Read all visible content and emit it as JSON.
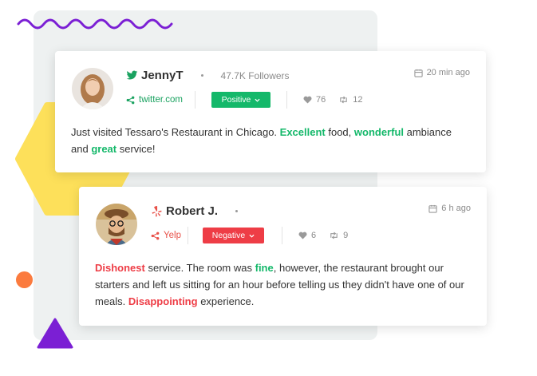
{
  "colors": {
    "positive": "#14b86a",
    "negative": "#ee3d46",
    "twitter": "#1da1f2",
    "yelp": "#e8524a",
    "accent_purple": "#7b1fd4",
    "accent_orange": "#fb7b3e",
    "accent_yellow": "#fde05a"
  },
  "reviews": [
    {
      "source_icon": "twitter-icon",
      "author": "JennyT",
      "followers": "47.7K Followers",
      "time": "20 min ago",
      "source_label": "twitter.com",
      "sentiment": "Positive",
      "likes": "76",
      "retweets": "12",
      "text": [
        {
          "t": "Just visited Tessaro's Restaurant in Chicago. "
        },
        {
          "t": "Excellent",
          "tone": "positive"
        },
        {
          "t": " food, "
        },
        {
          "t": "wonderful",
          "tone": "positive"
        },
        {
          "t": " ambiance and "
        },
        {
          "t": "great",
          "tone": "positive"
        },
        {
          "t": " service!"
        }
      ]
    },
    {
      "source_icon": "yelp-icon",
      "author": "Robert J.",
      "time": "6 h ago",
      "source_label": "Yelp",
      "sentiment": "Negative",
      "likes": "6",
      "retweets": "9",
      "text": [
        {
          "t": "Dishonest",
          "tone": "negative"
        },
        {
          "t": " service. The room was "
        },
        {
          "t": "fine",
          "tone": "positive"
        },
        {
          "t": ", however, the restaurant brought our starters and left us sitting for an hour before telling us they didn't have one of our meals. "
        },
        {
          "t": "Disappointing",
          "tone": "negative"
        },
        {
          "t": " experience."
        }
      ]
    }
  ]
}
